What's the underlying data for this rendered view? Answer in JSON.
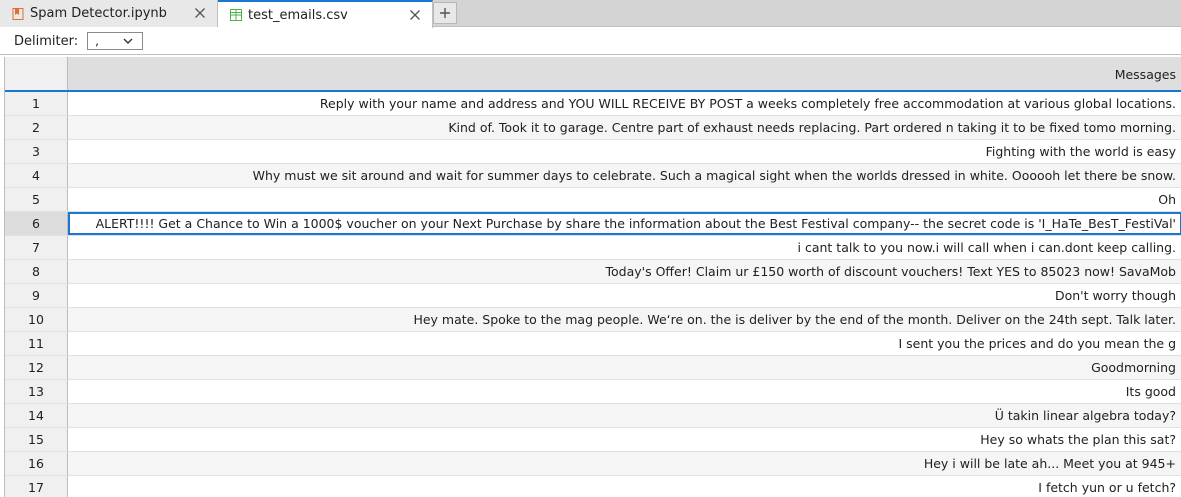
{
  "tabs": [
    {
      "label": "Spam Detector.ipynb",
      "icon": "notebook-icon",
      "active": false
    },
    {
      "label": "test_emails.csv",
      "icon": "table-icon",
      "active": true
    }
  ],
  "toolbar": {
    "delimiter_label": "Delimiter:",
    "delimiter_value": ","
  },
  "grid": {
    "column_header": "Messages",
    "selected_row": 6,
    "rows": [
      {
        "n": "1",
        "text": "Reply with your name and address and YOU WILL RECEIVE BY POST a weeks completely free accommodation at various global locations."
      },
      {
        "n": "2",
        "text": "Kind of. Took it to garage. Centre part of exhaust needs replacing. Part ordered n taking it to be fixed tomo morning."
      },
      {
        "n": "3",
        "text": "Fighting with the world is easy"
      },
      {
        "n": "4",
        "text": "Why must we sit around and wait for summer days to celebrate. Such a magical sight when the worlds dressed in white. Oooooh let there be snow."
      },
      {
        "n": "5",
        "text": "Oh"
      },
      {
        "n": "6",
        "text": "ALERT!!!! Get a Chance to Win a 1000$ voucher on your Next Purchase by share the information about the Best Festival company-- the secret code is 'I_HaTe_BesT_FestiVal'"
      },
      {
        "n": "7",
        "text": "i cant talk to you now.i will call when i can.dont keep calling."
      },
      {
        "n": "8",
        "text": "Today's Offer! Claim ur £150 worth of discount vouchers! Text YES to 85023 now! SavaMob"
      },
      {
        "n": "9",
        "text": "Don't worry though"
      },
      {
        "n": "10",
        "text": "Hey mate. Spoke to the mag people. We‘re on.  the is deliver by the end of the month. Deliver on the 24th sept. Talk later."
      },
      {
        "n": "11",
        "text": "I sent you the prices and do you mean the   g"
      },
      {
        "n": "12",
        "text": "Goodmorning"
      },
      {
        "n": "13",
        "text": "Its good"
      },
      {
        "n": "14",
        "text": "Ü takin linear algebra today?"
      },
      {
        "n": "15",
        "text": "Hey so whats the plan this sat?"
      },
      {
        "n": "16",
        "text": "Hey i will be late ah... Meet you at 945+"
      },
      {
        "n": "17",
        "text": "I fetch yun or u fetch?"
      }
    ]
  }
}
